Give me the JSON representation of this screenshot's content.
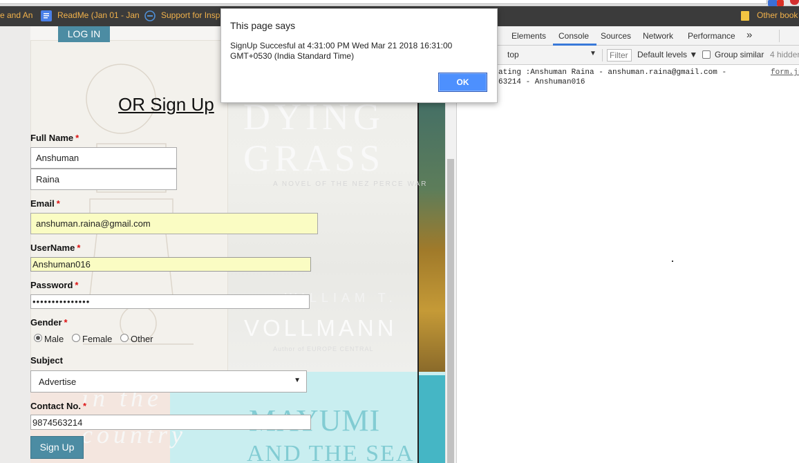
{
  "browser": {
    "bookmarks": [
      {
        "label": "e and An",
        "icon": "none"
      },
      {
        "label": "ReadMe (Jan 01 - Jan",
        "icon": "docs-icon"
      },
      {
        "label": "Support for Insp",
        "icon": "dell-icon"
      },
      {
        "label": "Other book",
        "icon": "folder-icon"
      }
    ]
  },
  "form": {
    "login_label": "LOG IN",
    "title": "OR Sign Up",
    "fullname_label": "Full Name",
    "required_mark": "*",
    "first_name": "Anshuman",
    "last_name": "Raina",
    "email_label": "Email",
    "email": "anshuman.raina@gmail.com",
    "username_label": "UserName",
    "username": "Anshuman016",
    "password_label": "Password",
    "password_mask": "•••••••••••••••",
    "gender_label": "Gender",
    "gender_options": [
      "Male",
      "Female",
      "Other"
    ],
    "gender_selected": "Male",
    "subject_label": "Subject",
    "subject_value": "Advertise",
    "contact_label": "Contact No.",
    "contact": "9874563214",
    "signup_label": "Sign Up"
  },
  "background_text": {
    "b1": "DYING",
    "b2": "GRASS",
    "b3": "A NOVEL OF THE NEZ PERCE WAR",
    "b4": "WILLIAM T.",
    "b5": "VOLLMANN",
    "b6": "Author of EUROPE CENTRAL",
    "b7": "MAYUMI",
    "b8": "AND THE SEA",
    "b9": "in the",
    "b10": "country"
  },
  "alert": {
    "title": "This page says",
    "message": "SignUp Succesful at 4:31:00 PM Wed Mar 21 2018 16:31:00 GMT+0530 (India Standard Time)",
    "ok_label": "OK"
  },
  "devtools": {
    "tabs": [
      "Elements",
      "Console",
      "Sources",
      "Network",
      "Performance"
    ],
    "active_tab": "Console",
    "more_tabs": "»",
    "context": "top",
    "filter_placeholder": "Filter",
    "levels": "Default levels ▼",
    "group_similar": "Group similar",
    "hidden_count": "4 hidden",
    "console_line1": "ating :Anshuman Raina - anshuman.raina@gmail.com -",
    "console_line2": "63214 - Anshuman016",
    "console_source": "form.js"
  },
  "colors": {
    "accent": "#4c8ca3",
    "autofill": "#fafcc3",
    "required": "#dd1111",
    "bookmark_text": "#f2b24b",
    "dialog_button": "#4d90fe"
  }
}
